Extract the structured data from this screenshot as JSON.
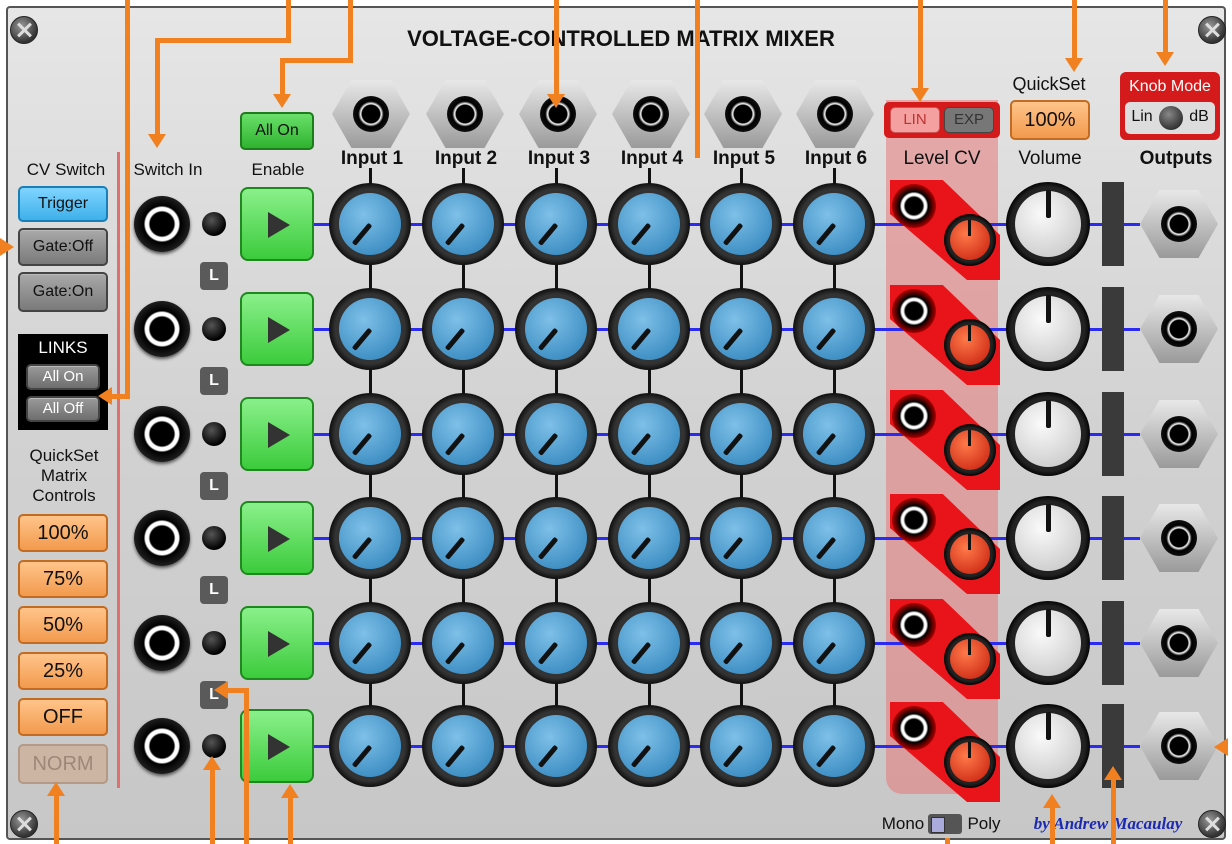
{
  "title": "VOLTAGE-CONTROLLED MATRIX MIXER",
  "left": {
    "cv_switch_label": "CV Switch",
    "buttons": [
      "Trigger",
      "Gate:Off",
      "Gate:On"
    ],
    "links_label": "LINKS",
    "links_buttons": [
      "All On",
      "All Off"
    ],
    "quickset_label_1": "QuickSet",
    "quickset_label_2": "Matrix",
    "quickset_label_3": "Controls",
    "quickset_buttons": [
      "100%",
      "75%",
      "50%",
      "25%",
      "OFF",
      "NORM"
    ]
  },
  "switch_in_label": "Switch In",
  "enable_label": "Enable",
  "all_on_button": "All On",
  "link_button_label": "L",
  "inputs": [
    "Input 1",
    "Input 2",
    "Input 3",
    "Input 4",
    "Input 5",
    "Input 6"
  ],
  "level_cv": {
    "label": "Level CV",
    "lin": "LIN",
    "exp": "EXP"
  },
  "quickset": {
    "label": "QuickSet",
    "value": "100%"
  },
  "volume_label": "Volume",
  "knob_mode": {
    "label": "Knob Mode",
    "lin": "Lin",
    "db": "dB"
  },
  "outputs_label": "Outputs",
  "mono_label": "Mono",
  "poly_label": "Poly",
  "credit": "by Andrew Macaulay",
  "colors": {
    "panel": "#d4d4d4",
    "knob_blue": "#4f9fd3",
    "accent_orange": "#f08020",
    "enable_green": "#4ad04a",
    "cv_red": "#e8141a"
  }
}
